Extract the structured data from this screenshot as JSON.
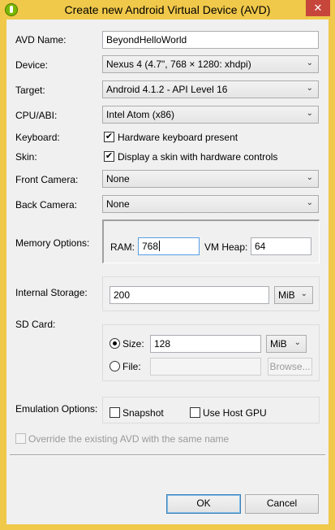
{
  "window": {
    "title": "Create new Android Virtual Device (AVD)",
    "close_glyph": "✕"
  },
  "form": {
    "avd_name": {
      "label": "AVD Name:",
      "value": "BeyondHelloWorld"
    },
    "device": {
      "label": "Device:",
      "value": "Nexus 4 (4.7\", 768 × 1280: xhdpi)"
    },
    "target": {
      "label": "Target:",
      "value": "Android 4.1.2 - API Level 16"
    },
    "cpu_abi": {
      "label": "CPU/ABI:",
      "value": "Intel Atom (x86)"
    },
    "keyboard": {
      "label": "Keyboard:",
      "checkbox_label": "Hardware keyboard present",
      "checked": true
    },
    "skin": {
      "label": "Skin:",
      "checkbox_label": "Display a skin with hardware controls",
      "checked": true
    },
    "front_camera": {
      "label": "Front Camera:",
      "value": "None"
    },
    "back_camera": {
      "label": "Back Camera:",
      "value": "None"
    },
    "memory": {
      "label": "Memory Options:",
      "ram_label": "RAM:",
      "ram_value": "768",
      "vm_heap_label": "VM Heap:",
      "vm_heap_value": "64"
    },
    "internal_storage": {
      "label": "Internal Storage:",
      "value": "200",
      "unit": "MiB"
    },
    "sd_card": {
      "label": "SD Card:",
      "size_label": "Size:",
      "size_value": "128",
      "size_unit": "MiB",
      "file_label": "File:",
      "file_value": "",
      "browse_label": "Browse...",
      "selected": "size"
    },
    "emulation": {
      "label": "Emulation Options:",
      "snapshot_label": "Snapshot",
      "snapshot_checked": false,
      "host_gpu_label": "Use Host GPU",
      "host_gpu_checked": false
    },
    "override": {
      "label": "Override the existing AVD with the same name",
      "checked": false
    }
  },
  "buttons": {
    "ok": "OK",
    "cancel": "Cancel"
  },
  "check_glyph": "✔",
  "dropdown_glyph": "⌄"
}
